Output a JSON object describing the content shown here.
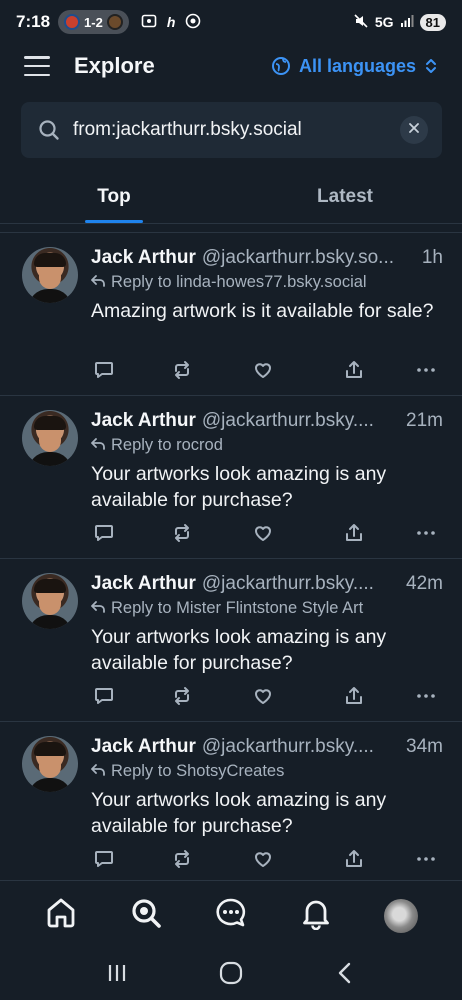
{
  "status_bar": {
    "time": "7:18",
    "score": "1-2",
    "network": "5G",
    "battery": "81"
  },
  "header": {
    "title": "Explore",
    "language_label": "All languages"
  },
  "search": {
    "value": "from:jackarthurr.bsky.social"
  },
  "tabs": [
    {
      "label": "Top",
      "active": true
    },
    {
      "label": "Latest",
      "active": false
    }
  ],
  "posts": [
    {
      "name": "Jack Arthur",
      "handle": "@jackarthurr.bsky.so...",
      "time": "1h",
      "reply_to": "Reply to linda-howes77.bsky.social",
      "text": "Amazing artwork is it available for sale?"
    },
    {
      "name": "Jack Arthur",
      "handle": "@jackarthurr.bsky....",
      "time": "21m",
      "reply_to": "Reply to rocrod",
      "text": "Your artworks look amazing is any available for purchase?"
    },
    {
      "name": "Jack Arthur",
      "handle": "@jackarthurr.bsky....",
      "time": "42m",
      "reply_to": "Reply to Mister Flintstone Style Art",
      "text": "Your artworks look amazing is any available for purchase?"
    },
    {
      "name": "Jack Arthur",
      "handle": "@jackarthurr.bsky....",
      "time": "34m",
      "reply_to": "Reply to ShotsyCreates",
      "text": "Your artworks look amazing is any available for purchase?"
    }
  ],
  "icons": {
    "post_actions": [
      "reply-icon",
      "repost-icon",
      "like-icon",
      "share-icon",
      "more-icon"
    ],
    "bottom_nav": [
      "home-icon",
      "search-icon",
      "chat-icon",
      "notifications-icon",
      "profile-avatar"
    ],
    "system_nav": [
      "recents-icon",
      "home-circle-icon",
      "back-icon"
    ]
  },
  "colors": {
    "background": "#161e27",
    "accent": "#1f84ee",
    "link": "#3c93f5",
    "muted_text": "#a7b2be"
  }
}
